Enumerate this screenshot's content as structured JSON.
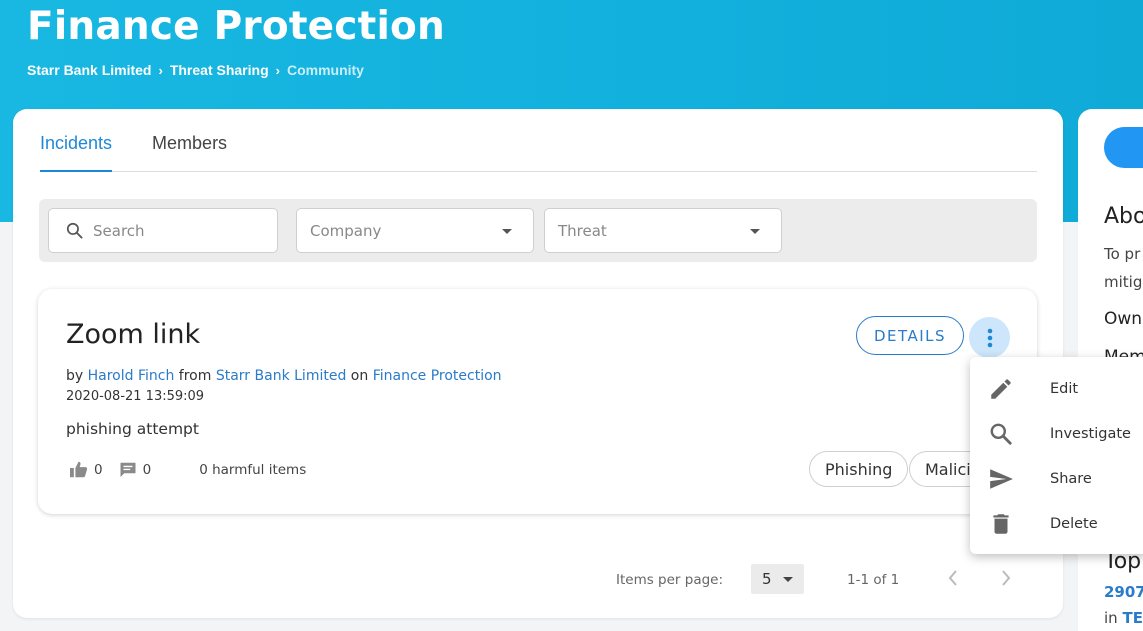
{
  "header": {
    "title": "Finance Protection",
    "breadcrumb": [
      "Starr Bank Limited",
      "Threat Sharing",
      "Community"
    ]
  },
  "tabs": [
    {
      "label": "Incidents",
      "active": true
    },
    {
      "label": "Members",
      "active": false
    }
  ],
  "filters": {
    "search_placeholder": "Search",
    "company_placeholder": "Company",
    "threat_placeholder": "Threat"
  },
  "incident": {
    "title": "Zoom link",
    "by_label": "by",
    "author": "Harold Finch",
    "from_label": "from",
    "company": "Starr Bank Limited",
    "on_label": "on",
    "community": "Finance Protection",
    "date": "2020-08-21 13:59:09",
    "description": "phishing attempt",
    "likes": "0",
    "comments": "0",
    "harmful_items": "0 harmful items",
    "details_label": "DETAILS",
    "tags": [
      "Phishing",
      "Malici"
    ]
  },
  "pagination": {
    "items_per_page_label": "Items per page:",
    "items_per_page": "5",
    "range": "1-1 of 1"
  },
  "context_menu": [
    {
      "label": "Edit",
      "icon": "pencil-icon"
    },
    {
      "label": "Investigate",
      "icon": "magnifier-icon"
    },
    {
      "label": "Share",
      "icon": "send-icon"
    },
    {
      "label": "Delete",
      "icon": "trash-icon"
    }
  ],
  "side_panel": {
    "heading_about": "Abo",
    "text_line1": "To pr",
    "text_line2": "mitiga",
    "owner_label": "Own",
    "members_label": "Mem",
    "heading_top": "Top",
    "top_count": "2907",
    "top_in_label": "in",
    "top_in_link": "TEs"
  },
  "colors": {
    "header_bg": "#15b3df",
    "link": "#2a7bc9",
    "accent": "#1e88d8",
    "more_button_bg": "#cde6fb"
  }
}
